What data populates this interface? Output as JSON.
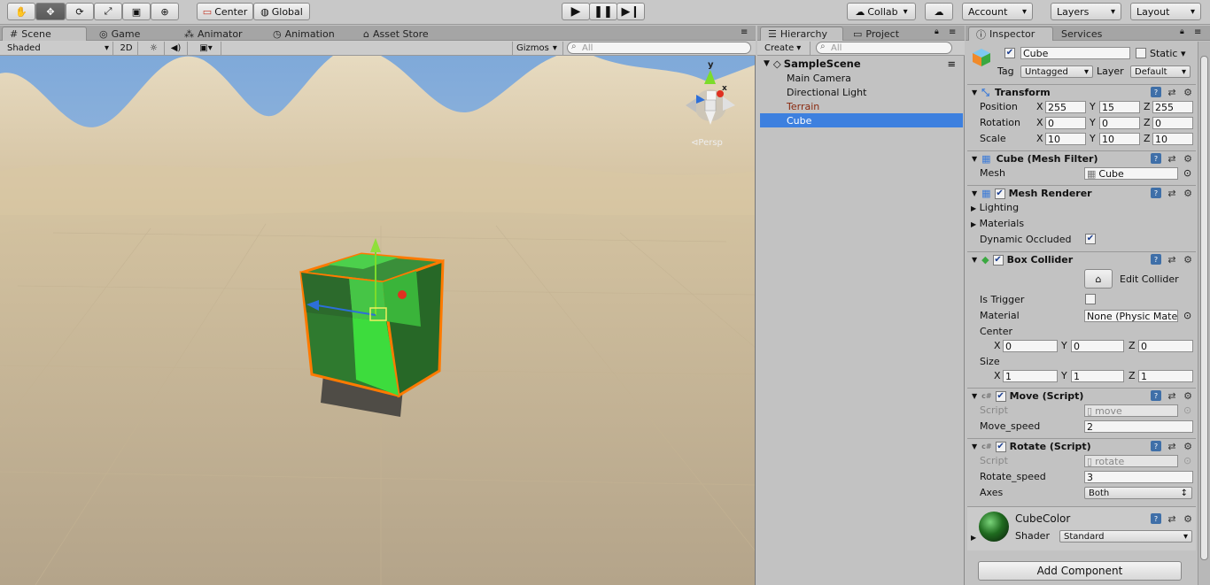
{
  "toolbar": {
    "tools": [
      "hand-tool-icon",
      "move-tool-icon",
      "rotate-tool-icon",
      "scale-tool-icon",
      "rect-tool-icon",
      "transform-tool-icon"
    ],
    "pivot_label": "Center",
    "space_label": "Global",
    "collab_label": "Collab",
    "account_label": "Account",
    "layers_label": "Layers",
    "layout_label": "Layout"
  },
  "scene_tabs": {
    "scene": "Scene",
    "game": "Game",
    "animator": "Animator",
    "animation": "Animation",
    "asset_store": "Asset Store"
  },
  "scene_bar": {
    "shading": "Shaded",
    "mode_2d": "2D",
    "gizmos": "Gizmos",
    "search_placeholder": "All"
  },
  "gizmo": {
    "y_label": "y",
    "x_label": "x",
    "persp_label": "Persp"
  },
  "hierarchy": {
    "tab_hierarchy": "Hierarchy",
    "tab_project": "Project",
    "create_label": "Create",
    "search_placeholder": "All",
    "scene_name": "SampleScene",
    "items": [
      "Main Camera",
      "Directional Light",
      "Terrain",
      "Cube"
    ],
    "selected": "Cube"
  },
  "inspector": {
    "tab_inspector": "Inspector",
    "tab_services": "Services",
    "object_name": "Cube",
    "static_label": "Static",
    "tag_label": "Tag",
    "tag_value": "Untagged",
    "layer_label": "Layer",
    "layer_value": "Default",
    "transform": {
      "title": "Transform",
      "position_label": "Position",
      "position": [
        "255",
        "15",
        "255"
      ],
      "rotation_label": "Rotation",
      "rotation": [
        "0",
        "0",
        "0"
      ],
      "scale_label": "Scale",
      "scale": [
        "10",
        "10",
        "10"
      ],
      "axis_x": "X",
      "axis_y": "Y",
      "axis_z": "Z"
    },
    "mesh_filter": {
      "title": "Cube (Mesh Filter)",
      "mesh_label": "Mesh",
      "mesh_value": "Cube"
    },
    "mesh_renderer": {
      "title": "Mesh Renderer",
      "lighting": "Lighting",
      "materials": "Materials",
      "dynamic_occluded": "Dynamic Occluded"
    },
    "box_collider": {
      "title": "Box Collider",
      "edit_collider": "Edit Collider",
      "is_trigger": "Is Trigger",
      "material_label": "Material",
      "material_value": "None (Physic Mate",
      "center_label": "Center",
      "center": [
        "0",
        "0",
        "0"
      ],
      "size_label": "Size",
      "size": [
        "1",
        "1",
        "1"
      ]
    },
    "move_script": {
      "title": "Move (Script)",
      "script_label": "Script",
      "script_value": "move",
      "speed_label": "Move_speed",
      "speed_value": "2"
    },
    "rotate_script": {
      "title": "Rotate (Script)",
      "script_label": "Script",
      "script_value": "rotate",
      "speed_label": "Rotate_speed",
      "speed_value": "3",
      "axes_label": "Axes",
      "axes_value": "Both"
    },
    "material": {
      "name": "CubeColor",
      "shader_label": "Shader",
      "shader_value": "Standard"
    },
    "add_component": "Add Component"
  },
  "colors": {
    "selection": "#3d80df",
    "terrain_item": "#8a2a10",
    "cube_green": "#3ddc3d",
    "outline": "#ff7a00"
  }
}
